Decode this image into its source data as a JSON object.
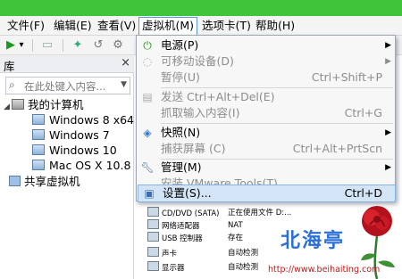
{
  "menubar": {
    "items": [
      "文件(F)",
      "编辑(E)",
      "查看(V)",
      "虚拟机(M)",
      "选项卡(T)",
      "帮助(H)"
    ]
  },
  "toolbar": {
    "play": "▶",
    "dropdown": "▾"
  },
  "library": {
    "title": "库",
    "close": "×",
    "search_placeholder": "在此处键入内容...",
    "tree": {
      "root": "我的计算机",
      "vms": [
        "Windows 8 x64",
        "Windows 7",
        "Windows 10",
        "Mac OS X 10.8"
      ],
      "shared": "共享虚拟机"
    }
  },
  "devices": [
    {
      "name": "CD/DVD (SATA)",
      "value": "正在使用文件 D:..."
    },
    {
      "name": "网络适配器",
      "value": "NAT"
    },
    {
      "name": "USB 控制器",
      "value": "存在"
    },
    {
      "name": "声卡",
      "value": "自动检测"
    },
    {
      "name": "显示器",
      "value": "自动检测"
    }
  ],
  "vm_menu": {
    "items": [
      {
        "label": "电源(P)",
        "shortcut": "",
        "submenu": true,
        "disabled": false,
        "icon": "power-icon"
      },
      {
        "label": "可移动设备(D)",
        "shortcut": "",
        "submenu": true,
        "disabled": true,
        "icon": "removable-device-icon"
      },
      {
        "label": "暂停(U)",
        "shortcut": "Ctrl+Shift+P",
        "submenu": false,
        "disabled": true,
        "icon": ""
      },
      {
        "label": "发送 Ctrl+Alt+Del(E)",
        "shortcut": "",
        "submenu": false,
        "disabled": true,
        "icon": "ctrl-alt-del-icon"
      },
      {
        "label": "抓取输入内容(I)",
        "shortcut": "Ctrl+G",
        "submenu": false,
        "disabled": true,
        "icon": ""
      },
      {
        "label": "快照(N)",
        "shortcut": "",
        "submenu": true,
        "disabled": false,
        "icon": "snapshot-icon"
      },
      {
        "label": "捕获屏幕 (C)",
        "shortcut": "Ctrl+Alt+PrtScn",
        "submenu": false,
        "disabled": true,
        "icon": ""
      },
      {
        "label": "管理(M)",
        "shortcut": "",
        "submenu": true,
        "disabled": false,
        "icon": "wrench-icon"
      },
      {
        "label": "安装 VMware Tools(T)...",
        "shortcut": "",
        "submenu": false,
        "disabled": true,
        "icon": ""
      },
      {
        "label": "设置(S)...",
        "shortcut": "Ctrl+D",
        "submenu": false,
        "disabled": false,
        "icon": "settings-icon",
        "highlighted": true
      }
    ]
  },
  "watermark": {
    "title": "北海亭",
    "url": "http://www.beihaiting.com"
  },
  "colors": {
    "titlebar": "#3fc43a",
    "menu_highlight": "#d3e4f7",
    "watermark_blue": "#2a6fd8",
    "watermark_red": "#c01818"
  }
}
